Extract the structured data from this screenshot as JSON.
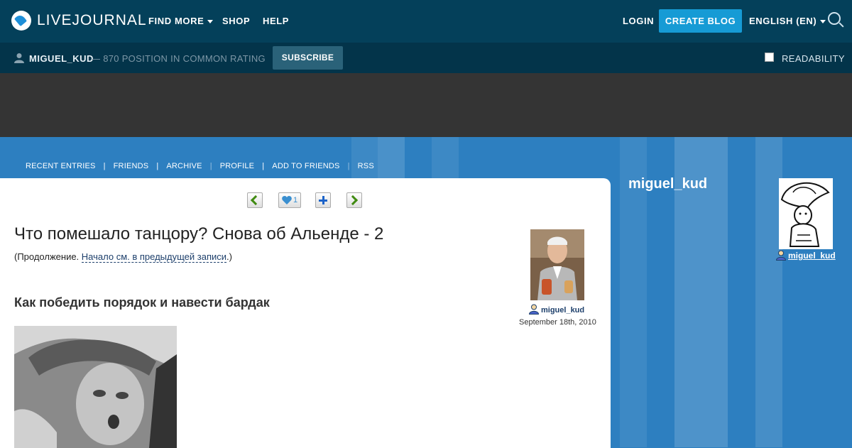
{
  "header": {
    "logo_text": "LIVEJOURNAL",
    "nav": [
      "FIND MORE",
      "SHOP",
      "HELP"
    ],
    "login": "LOGIN",
    "create_blog": "CREATE BLOG",
    "language": "ENGLISH (EN)"
  },
  "userbar": {
    "username": "MIGUEL_KUD",
    "rating": "— 870 POSITION IN COMMON RATING",
    "subscribe": "SUBSCRIBE",
    "readability": "READABILITY"
  },
  "blog_nav": [
    "RECENT ENTRIES",
    "FRIENDS",
    "ARCHIVE",
    "PROFILE",
    "ADD TO FRIENDS",
    "RSS"
  ],
  "post": {
    "like_count": "1",
    "title": "Что помешало танцору? Снова об Альенде - 2",
    "intro_before": "(Продолжение. ",
    "intro_link": "Начало см. в предыдущей записи",
    "intro_after": ".)",
    "heading": "Как победить порядок и навести бардак",
    "author": "miguel_kud",
    "date": "September 18th, 2010"
  },
  "sidebar": {
    "title": "miguel_kud",
    "user_link": "miguel_kud"
  },
  "colors": {
    "topbar": "#04405a",
    "userbar": "#03344a",
    "accent": "#169bd5",
    "page_bg": "#2d7fc0"
  }
}
